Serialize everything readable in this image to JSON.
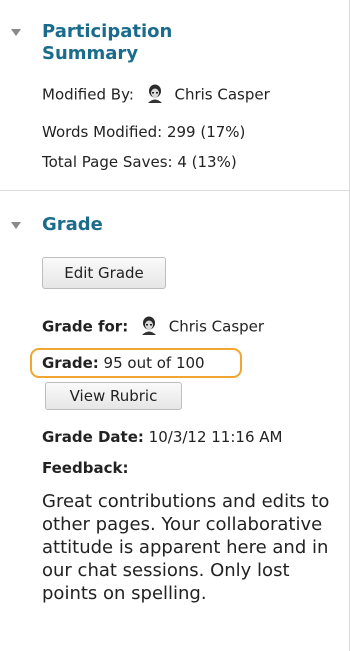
{
  "participation": {
    "title": "Participation Summary",
    "modified_by_label": "Modified By:",
    "modified_by_name": "Chris Casper",
    "words_modified": "Words Modified: 299 (17%)",
    "total_page_saves": "Total Page Saves: 4 (13%)"
  },
  "grade": {
    "title": "Grade",
    "edit_button": "Edit Grade",
    "grade_for_label": "Grade for:",
    "grade_for_name": "Chris Casper",
    "grade_label": "Grade:",
    "grade_value": "95 out of 100",
    "view_rubric_button": "View Rubric",
    "grade_date_label": "Grade Date:",
    "grade_date_value": "10/3/12 11:16 AM",
    "feedback_label": "Feedback:",
    "feedback_text": "Great contributions and edits to other pages. Your collaborative attitude is apparent here and in our chat sessions. Only lost points on spelling."
  },
  "colors": {
    "title_blue": "#1b6c8c",
    "highlight_orange": "#f0a630"
  }
}
